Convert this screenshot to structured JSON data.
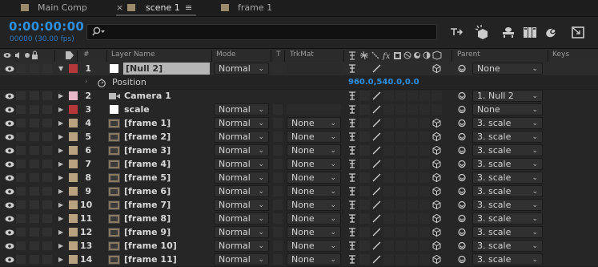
{
  "tabs": [
    {
      "label": "Main Comp",
      "color": "#9d8a6b",
      "active": false
    },
    {
      "label": "scene 1",
      "color": "#9d8a6b",
      "active": true
    },
    {
      "label": "frame 1",
      "color": "#9d8a6b",
      "active": false
    }
  ],
  "tab_close_glyph": "×",
  "tab_menu_glyph": "≡",
  "timecode": "0:00:00:00",
  "fps_text": "00000 (30.00 fps)",
  "search": {
    "placeholder": ""
  },
  "headers": {
    "layer_name": "Layer Name",
    "mode": "Mode",
    "t": "T",
    "trkmat": "TrkMat",
    "parent": "Parent",
    "keys": "Keys",
    "hash": "#"
  },
  "position_row": {
    "label": "Position",
    "value": "960.0,540.0,0.0"
  },
  "layers": [
    {
      "num": "1",
      "name": "[Null 2]",
      "label_color": "#b5373a",
      "swatch": "#ffffff",
      "mode": "Normal",
      "trkmat": "",
      "parent": "None",
      "selected": true,
      "kind": "null",
      "expanded": true
    },
    {
      "num": "2",
      "name": "Camera 1",
      "label_color": "#e5b9c7",
      "swatch": "",
      "mode": "",
      "trkmat": "",
      "parent": "1. Null 2",
      "selected": false,
      "kind": "camera"
    },
    {
      "num": "3",
      "name": "scale",
      "label_color": "#b5373a",
      "swatch": "#ffffff",
      "mode": "Normal",
      "trkmat": "",
      "parent": "None",
      "selected": false,
      "kind": "solid"
    },
    {
      "num": "4",
      "name": "[frame 1]",
      "label_color": "#b9a27f",
      "mode": "Normal",
      "trkmat": "None",
      "parent": "3. scale",
      "kind": "comp"
    },
    {
      "num": "5",
      "name": "[frame 2]",
      "label_color": "#b9a27f",
      "mode": "Normal",
      "trkmat": "None",
      "parent": "3. scale",
      "kind": "comp"
    },
    {
      "num": "6",
      "name": "[frame 3]",
      "label_color": "#b9a27f",
      "mode": "Normal",
      "trkmat": "None",
      "parent": "3. scale",
      "kind": "comp"
    },
    {
      "num": "7",
      "name": "[frame 4]",
      "label_color": "#b9a27f",
      "mode": "Normal",
      "trkmat": "None",
      "parent": "3. scale",
      "kind": "comp"
    },
    {
      "num": "8",
      "name": "[frame 5]",
      "label_color": "#b9a27f",
      "mode": "Normal",
      "trkmat": "None",
      "parent": "3. scale",
      "kind": "comp"
    },
    {
      "num": "9",
      "name": "[frame 6]",
      "label_color": "#b9a27f",
      "mode": "Normal",
      "trkmat": "None",
      "parent": "3. scale",
      "kind": "comp"
    },
    {
      "num": "10",
      "name": "[frame 7]",
      "label_color": "#b9a27f",
      "mode": "Normal",
      "trkmat": "None",
      "parent": "3. scale",
      "kind": "comp"
    },
    {
      "num": "11",
      "name": "[frame 8]",
      "label_color": "#b9a27f",
      "mode": "Normal",
      "trkmat": "None",
      "parent": "3. scale",
      "kind": "comp"
    },
    {
      "num": "12",
      "name": "[frame 9]",
      "label_color": "#b9a27f",
      "mode": "Normal",
      "trkmat": "None",
      "parent": "3. scale",
      "kind": "comp"
    },
    {
      "num": "13",
      "name": "[frame 10]",
      "label_color": "#b9a27f",
      "mode": "Normal",
      "trkmat": "None",
      "parent": "3. scale",
      "kind": "comp"
    },
    {
      "num": "14",
      "name": "[frame 11]",
      "label_color": "#b9a27f",
      "mode": "Normal",
      "trkmat": "None",
      "parent": "3. scale",
      "kind": "comp"
    }
  ],
  "colors": {
    "accent": "#2c8fe0",
    "panel_bg": "#232323"
  },
  "toolbar_icons": [
    "draft-3d-icon",
    "shy-layers-icon",
    "frame-blending-icon",
    "motion-blur-icon",
    "graph-editor-icon",
    "comp-flowchart-icon"
  ]
}
